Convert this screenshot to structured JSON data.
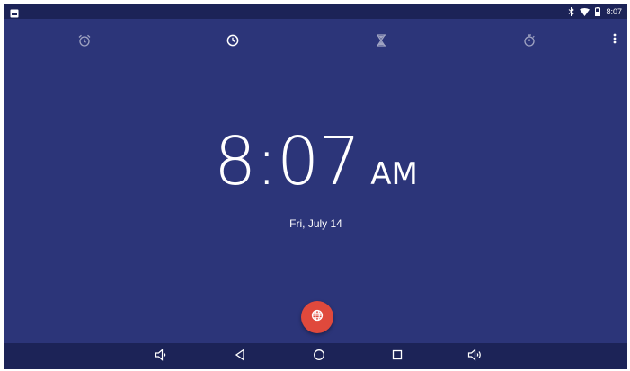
{
  "status_bar": {
    "time": "8:07",
    "icons": [
      "notification-icon",
      "bluetooth-icon",
      "wifi-icon",
      "battery-icon"
    ]
  },
  "tabs": [
    {
      "name": "alarm",
      "icon": "alarm-icon",
      "selected": false
    },
    {
      "name": "clock",
      "icon": "clock-icon",
      "selected": true
    },
    {
      "name": "timer",
      "icon": "hourglass-icon",
      "selected": false
    },
    {
      "name": "stopwatch",
      "icon": "stopwatch-icon",
      "selected": false
    }
  ],
  "clock": {
    "time": "8:07",
    "ampm": "AM",
    "date": "Fri, July 14"
  },
  "fab": {
    "icon": "globe-icon",
    "color": "#e0493c"
  },
  "nav_bar": {
    "buttons": [
      "volume-down-icon",
      "back-icon",
      "home-icon",
      "recents-icon",
      "volume-up-icon"
    ]
  },
  "colors": {
    "background": "#2c3579",
    "bars": "#1c2357",
    "accent": "#e0493c"
  }
}
